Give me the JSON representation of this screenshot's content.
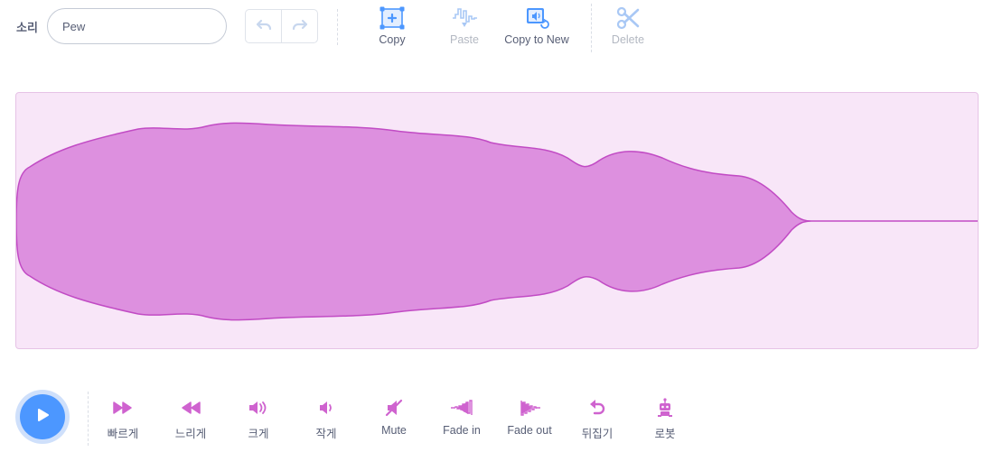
{
  "header": {
    "sound_label": "소리",
    "sound_name": "Pew",
    "tools": [
      {
        "label": "Copy",
        "icon": "copy-icon",
        "enabled": true
      },
      {
        "label": "Paste",
        "icon": "paste-icon",
        "enabled": false
      },
      {
        "label": "Copy to New",
        "icon": "copy-to-new-icon",
        "enabled": true
      },
      {
        "label": "Delete",
        "icon": "scissors-icon",
        "enabled": false
      }
    ]
  },
  "effects": [
    {
      "label": "빠르게",
      "icon": "faster-icon"
    },
    {
      "label": "느리게",
      "icon": "slower-icon"
    },
    {
      "label": "크게",
      "icon": "louder-icon"
    },
    {
      "label": "작게",
      "icon": "softer-icon"
    },
    {
      "label": "Mute",
      "icon": "mute-icon"
    },
    {
      "label": "Fade in",
      "icon": "fade-in-icon"
    },
    {
      "label": "Fade out",
      "icon": "fade-out-icon"
    },
    {
      "label": "뒤집기",
      "icon": "reverse-icon"
    },
    {
      "label": "로봇",
      "icon": "robot-icon"
    }
  ],
  "colors": {
    "accent": "#4c97ff",
    "waveform_fill": "#dd90df",
    "waveform_stroke": "#c14bc4",
    "waveform_background": "#f8e6f8",
    "effect_icon": "#cf63cf"
  }
}
